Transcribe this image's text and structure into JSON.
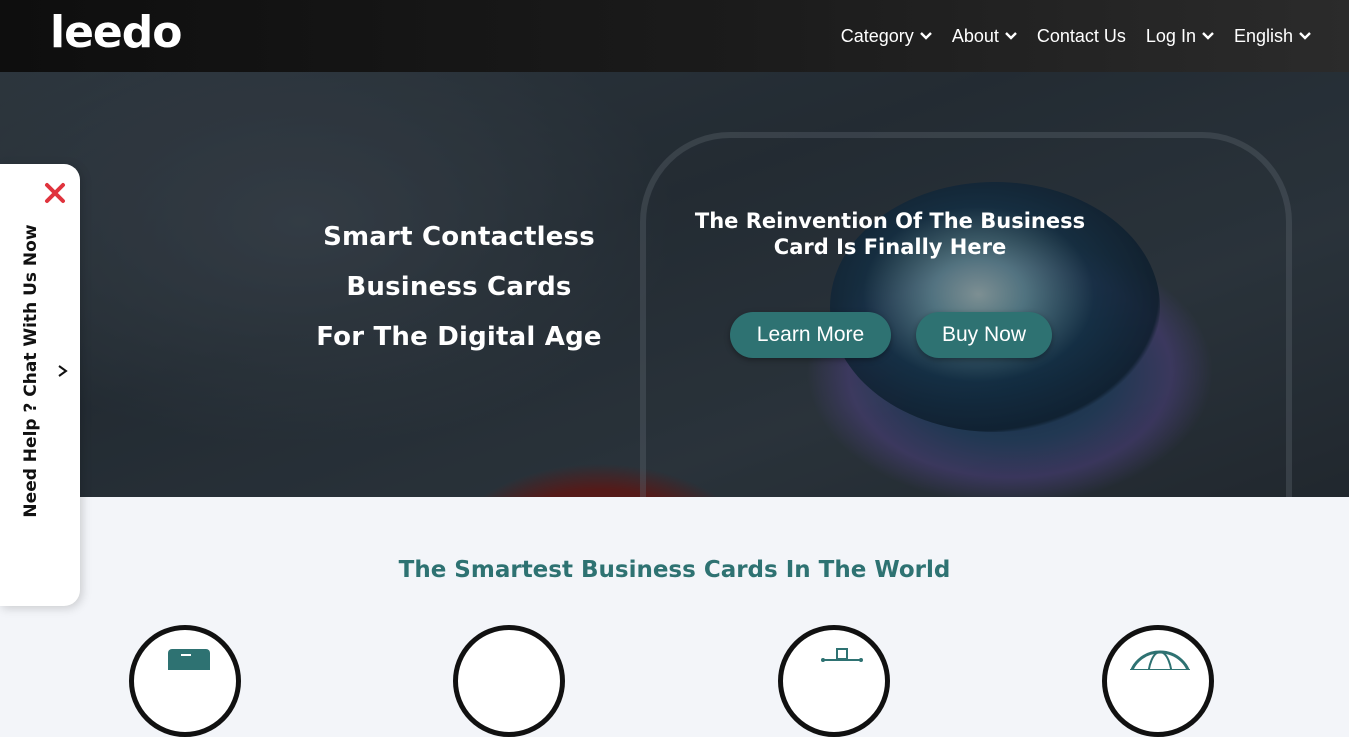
{
  "brand": {
    "logo_text": "leedo"
  },
  "nav": {
    "items": [
      {
        "label": "Category",
        "has_dropdown": true
      },
      {
        "label": "About",
        "has_dropdown": true
      },
      {
        "label": "Contact Us",
        "has_dropdown": false
      },
      {
        "label": "Log In",
        "has_dropdown": true
      },
      {
        "label": "English",
        "has_dropdown": true
      }
    ]
  },
  "hero": {
    "headline_lines": [
      "Smart Contactless",
      "Business Cards",
      "For The Digital Age"
    ],
    "tagline_lines": [
      "The Reinvention Of The Business",
      "Card Is Finally Here"
    ],
    "learn_more_label": "Learn More",
    "buy_now_label": "Buy Now"
  },
  "chat_widget": {
    "text": "Need Help ? Chat With Us Now",
    "close_icon": "close-icon",
    "arrow_icon": "chevron-icon"
  },
  "features": {
    "title": "The Smartest Business Cards In The World",
    "icons": [
      "card-icon",
      "phone-icon",
      "share-icon",
      "globe-icon"
    ]
  },
  "colors": {
    "accent": "#2e7272",
    "close": "#e0333d",
    "navbar": "#151515"
  }
}
